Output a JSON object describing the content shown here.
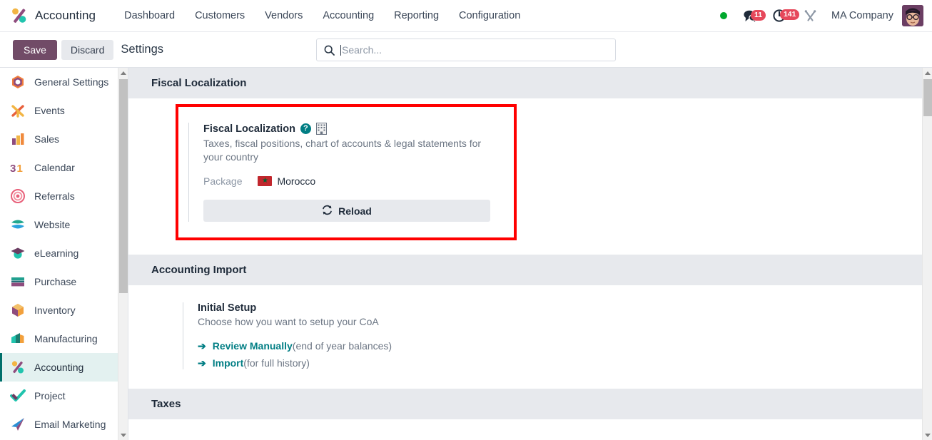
{
  "app": {
    "brand_name": "Accounting",
    "brand_icon": "accounting-app-icon"
  },
  "navbar": {
    "menu_items": [
      {
        "label": "Dashboard"
      },
      {
        "label": "Customers"
      },
      {
        "label": "Vendors"
      },
      {
        "label": "Accounting"
      },
      {
        "label": "Reporting"
      },
      {
        "label": "Configuration"
      }
    ],
    "status_indicator": "online-dot",
    "messages": {
      "icon": "messages-icon",
      "count": "11"
    },
    "activities": {
      "icon": "activity-clock-icon",
      "count": "141"
    },
    "tools_icon": "developer-tools-icon",
    "company": "MA Company",
    "avatar": "user-avatar"
  },
  "control_panel": {
    "save_label": "Save",
    "discard_label": "Discard",
    "title": "Settings",
    "search": {
      "placeholder": "Search...",
      "value": "",
      "icon": "search-icon"
    }
  },
  "sidebar": {
    "items": [
      {
        "label": "General Settings",
        "icon": "general-settings-icon",
        "active": false
      },
      {
        "label": "Events",
        "icon": "events-icon",
        "active": false
      },
      {
        "label": "Sales",
        "icon": "sales-icon",
        "active": false
      },
      {
        "label": "Calendar",
        "icon": "calendar-icon",
        "active": false
      },
      {
        "label": "Referrals",
        "icon": "referrals-icon",
        "active": false
      },
      {
        "label": "Website",
        "icon": "website-icon",
        "active": false
      },
      {
        "label": "eLearning",
        "icon": "elearning-icon",
        "active": false
      },
      {
        "label": "Purchase",
        "icon": "purchase-icon",
        "active": false
      },
      {
        "label": "Inventory",
        "icon": "inventory-icon",
        "active": false
      },
      {
        "label": "Manufacturing",
        "icon": "manufacturing-icon",
        "active": false
      },
      {
        "label": "Accounting",
        "icon": "accounting-icon",
        "active": true
      },
      {
        "label": "Project",
        "icon": "project-icon",
        "active": false
      },
      {
        "label": "Email Marketing",
        "icon": "email-marketing-icon",
        "active": false
      }
    ]
  },
  "sections": {
    "fiscal_localization": {
      "heading": "Fiscal Localization",
      "setting_title": "Fiscal Localization",
      "help_icon": "help-circle-icon",
      "company_icon": "company-building-icon",
      "description": "Taxes, fiscal positions, chart of accounts & legal statements for your country",
      "package_label": "Package",
      "package_value": "Morocco",
      "package_flag": "morocco-flag-icon",
      "reload_label": "Reload",
      "reload_icon": "refresh-icon",
      "highlighted": true
    },
    "accounting_import": {
      "heading": "Accounting Import",
      "setting_title": "Initial Setup",
      "description": "Choose how you want to setup your CoA",
      "links": [
        {
          "arrow": "arrow-right-icon",
          "label": "Review Manually",
          "note": "(end of year balances)"
        },
        {
          "arrow": "arrow-right-icon",
          "label": "Import",
          "note": "(for full history)"
        }
      ]
    },
    "taxes": {
      "heading": "Taxes"
    }
  },
  "colors": {
    "accent_teal": "#017e84",
    "brand_purple": "#714b67",
    "highlight_red": "#ff0000",
    "badge_red": "#e6485b",
    "section_bg": "#e7e9ed",
    "active_sidebar": "#e3f1f0"
  }
}
